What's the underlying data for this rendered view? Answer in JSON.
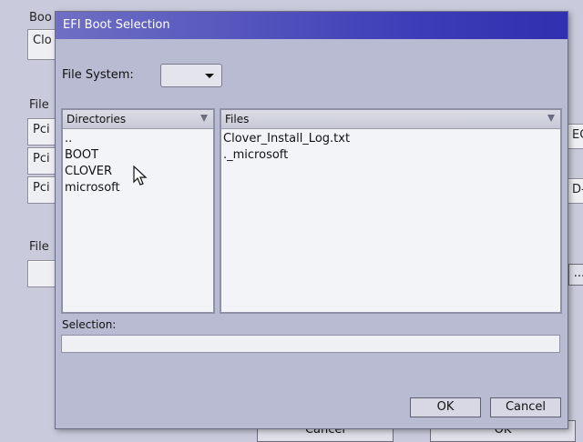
{
  "background": {
    "labels": [
      "Boo",
      "File",
      "File"
    ],
    "field_top": "Clo",
    "pci_rows": [
      "Pci",
      "Pci",
      "Pci"
    ],
    "right_bits": [
      "EC",
      "D-",
      "..."
    ],
    "bottom_buttons": [
      "Cancel",
      "OK"
    ]
  },
  "dialog": {
    "title": "EFI Boot Selection",
    "file_system_label": "File System:",
    "file_system_value": "",
    "directories_header": "Directories",
    "directories": [
      "..",
      "BOOT",
      "CLOVER",
      "microsoft"
    ],
    "files_header": "Files",
    "files": [
      "Clover_Install_Log.txt",
      "._microsoft"
    ],
    "selection_label": "Selection:",
    "selection_value": "",
    "ok_label": "OK",
    "cancel_label": "Cancel"
  },
  "icons": {
    "cursor": "mouse-pointer-icon",
    "dropdown": "chevron-down-icon",
    "filter": "filter-icon"
  },
  "colors": {
    "title_gradient_start": "#6f6fc4",
    "title_gradient_end": "#3030b0",
    "dialog_bg": "#b9bbd2"
  }
}
